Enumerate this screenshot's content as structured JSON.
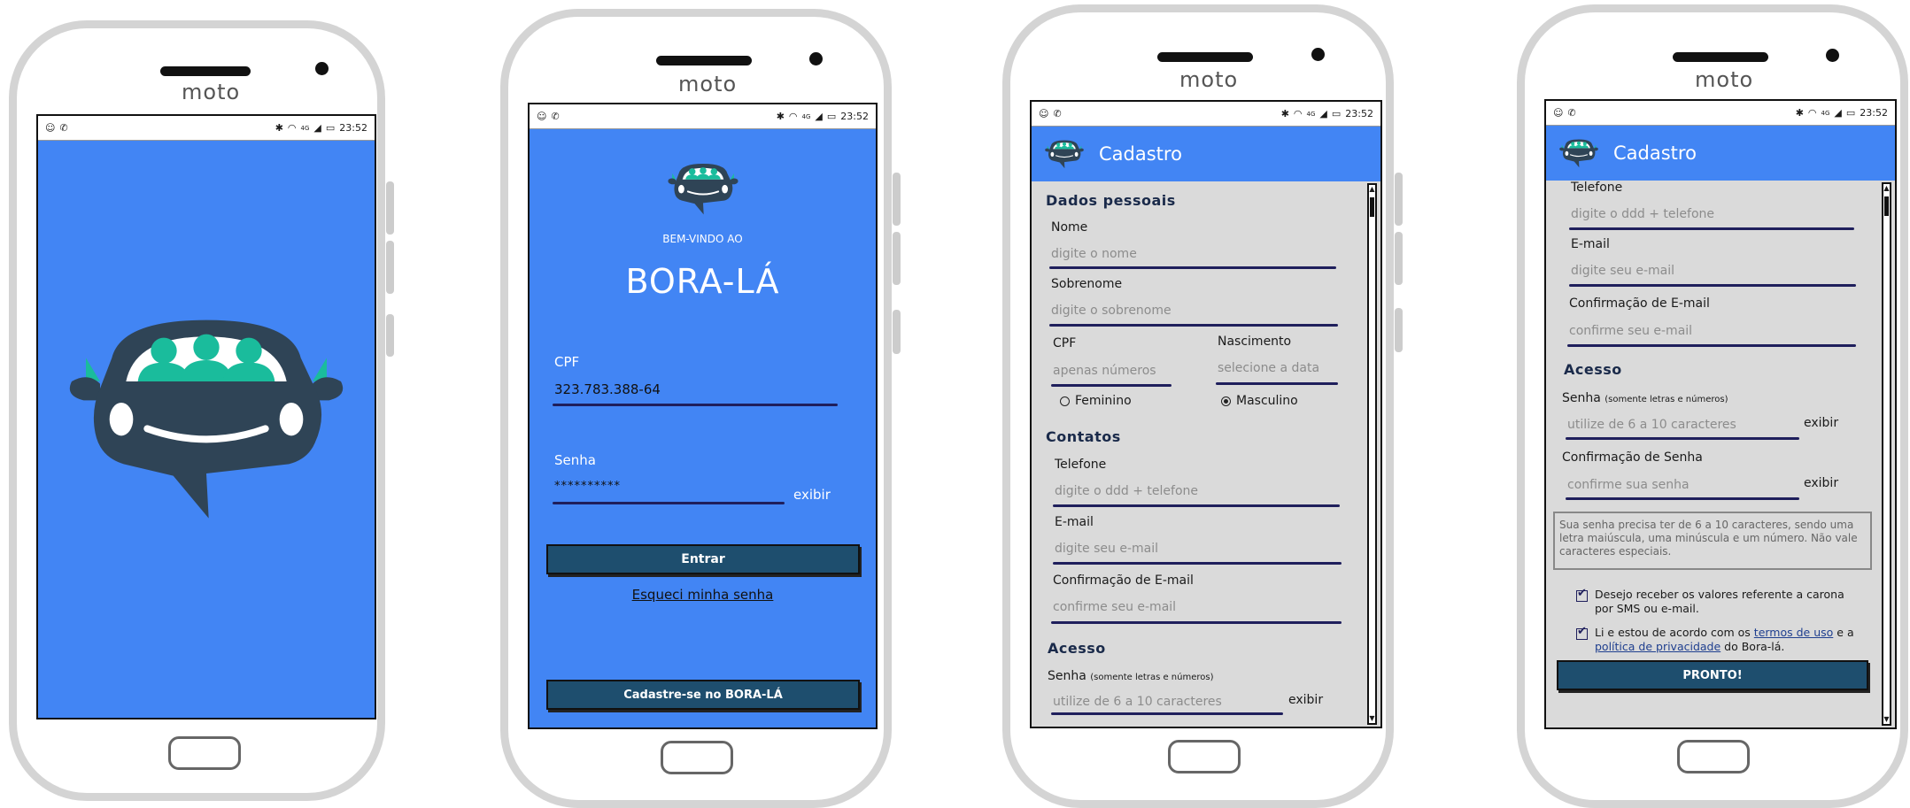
{
  "status": {
    "time": "23:52",
    "network": "4G"
  },
  "brand": "moto",
  "colors": {
    "primary": "#4285f4",
    "dark_button": "#1e4e6e",
    "underline": "#1f1f5c",
    "form_bg": "#dadada"
  },
  "splash": {
    "logo_icon": "car-with-passengers-logo"
  },
  "login": {
    "welcome": "BEM-VINDO AO",
    "app_name": "BORA-LÁ",
    "cpf_label": "CPF",
    "cpf_value": "323.783.388-64",
    "senha_label": "Senha",
    "senha_value": "**********",
    "exibir": "exibir",
    "entrar": "Entrar",
    "forgot": "Esqueci minha senha",
    "signup": "Cadastre-se no BORA-LÁ"
  },
  "signup1": {
    "title": "Cadastro",
    "dados_pessoais": "Dados pessoais",
    "nome_label": "Nome",
    "nome_ph": "digite o nome",
    "sobrenome_label": "Sobrenome",
    "sobrenome_ph": "digite o sobrenome",
    "cpf_label": "CPF",
    "cpf_ph": "apenas números",
    "nascimento_label": "Nascimento",
    "nascimento_ph": "selecione a data",
    "feminino": "Feminino",
    "masculino": "Masculino",
    "contatos": "Contatos",
    "telefone_label": "Telefone",
    "telefone_ph": "digite o ddd + telefone",
    "email_label": "E-mail",
    "email_ph": "digite seu e-mail",
    "conf_email_label": "Confirmação de E-mail",
    "conf_email_ph": "confirme seu e-mail",
    "acesso": "Acesso",
    "senha_label": "Senha",
    "senha_hint": "(somente letras e números)",
    "senha_ph": "utilize de 6 a 10 caracteres",
    "exibir": "exibir"
  },
  "signup2": {
    "title": "Cadastro",
    "telefone_label": "Telefone",
    "telefone_ph": "digite o ddd + telefone",
    "email_label": "E-mail",
    "email_ph": "digite seu e-mail",
    "conf_email_label": "Confirmação de E-mail",
    "conf_email_ph": "confirme seu e-mail",
    "acesso": "Acesso",
    "senha_label": "Senha",
    "senha_hint": "(somente letras e números)",
    "senha_ph": "utilize de 6 a 10 caracteres",
    "exibir": "exibir",
    "conf_senha_label": "Confirmação de Senha",
    "conf_senha_ph": "confirme sua senha",
    "note": "Sua senha precisa ter de 6 a 10 caracteres, sendo uma letra maiúscula, uma minúscula e um número. Não vale caracteres especiais.",
    "check1": "Desejo receber os valores referente a carona por SMS ou e-mail.",
    "check2_pre": "Li e estou de acordo com os",
    "check2_terms": "termos de uso",
    "check2_mid": "e a",
    "check2_privacy": "política de privacidade",
    "check2_post": "do Bora-lá.",
    "pronto": "PRONTO!"
  }
}
